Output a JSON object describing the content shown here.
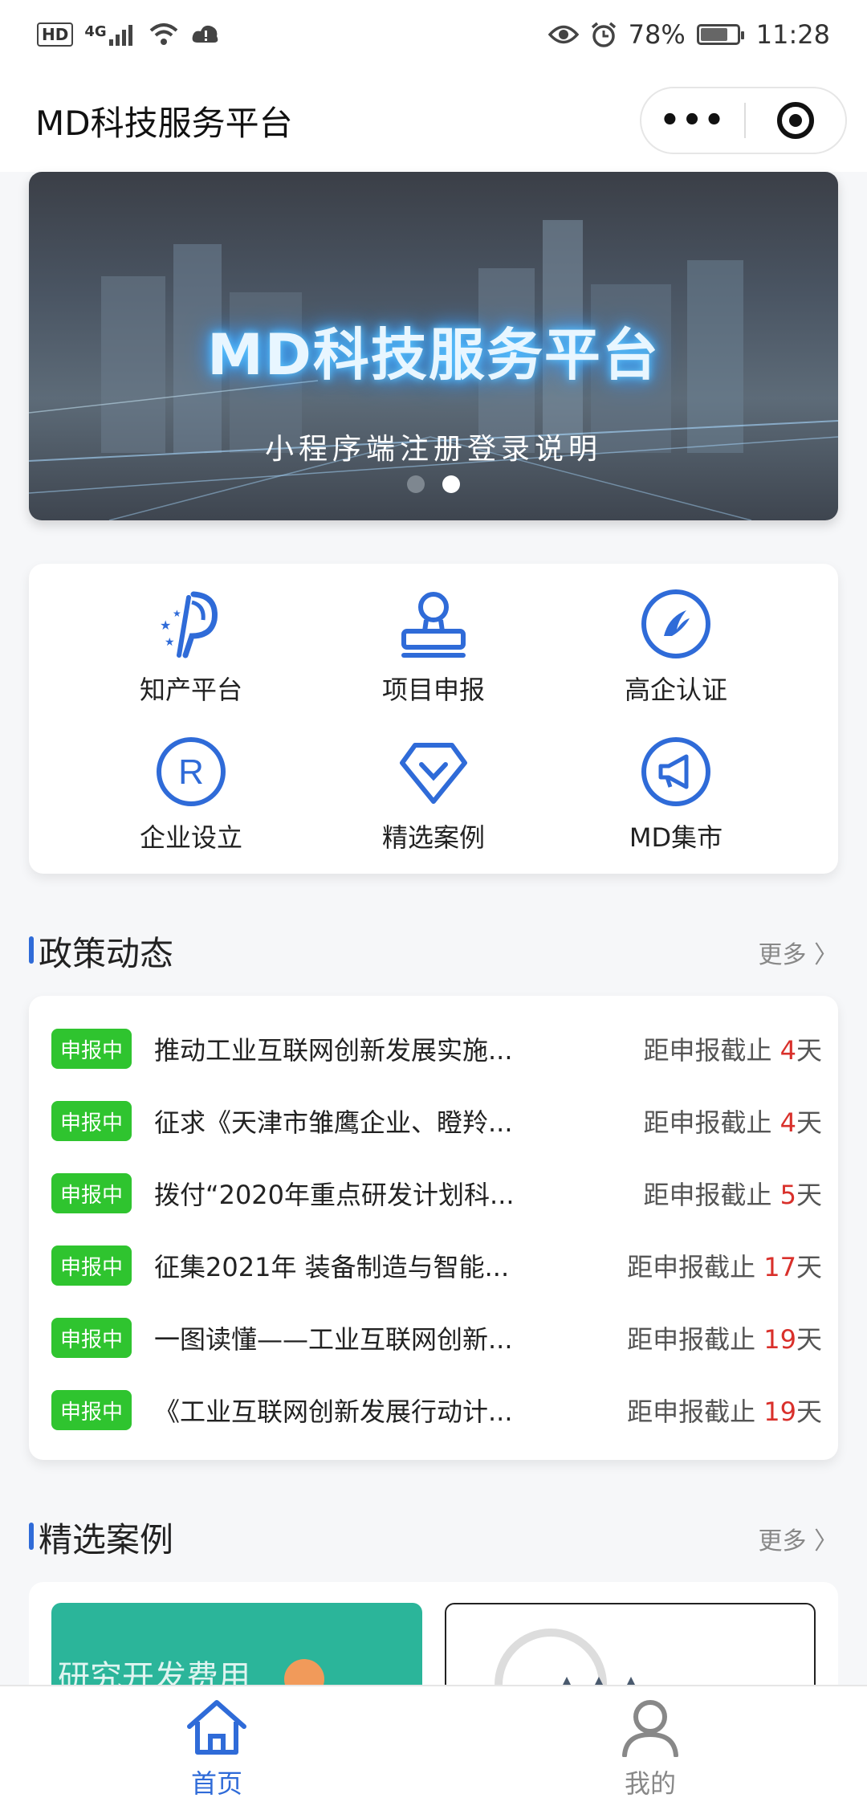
{
  "status_bar": {
    "hd": "HD",
    "network": "4G",
    "battery": "78%",
    "time": "11:28"
  },
  "nav": {
    "title": "MD科技服务平台",
    "more_glyph": "•••"
  },
  "banner": {
    "title": "MD科技服务平台",
    "subtitle": "小程序端注册登录说明",
    "active_dot": 2,
    "dot_count": 2
  },
  "services": [
    {
      "label": "知产平台",
      "icon": "ip-platform-icon"
    },
    {
      "label": "项目申报",
      "icon": "stamp-icon"
    },
    {
      "label": "高企认证",
      "icon": "hightech-certify-icon"
    },
    {
      "label": "企业设立",
      "icon": "registered-r-icon"
    },
    {
      "label": "精选案例",
      "icon": "diamond-icon"
    },
    {
      "label": "MD集市",
      "icon": "megaphone-icon"
    }
  ],
  "policy_section": {
    "title": "政策动态",
    "more": "更多 〉",
    "items": [
      {
        "badge": "申报中",
        "title": "推动工业互联网创新发展实施...",
        "deadline_prefix": "距申报截止 ",
        "days": "4",
        "unit": "天"
      },
      {
        "badge": "申报中",
        "title": "征求《天津市雏鹰企业、瞪羚...",
        "deadline_prefix": "距申报截止 ",
        "days": "4",
        "unit": "天"
      },
      {
        "badge": "申报中",
        "title": "拨付“2020年重点研发计划科...",
        "deadline_prefix": "距申报截止 ",
        "days": "5",
        "unit": "天"
      },
      {
        "badge": "申报中",
        "title": "征集2021年 装备制造与智能...",
        "deadline_prefix": "距申报截止 ",
        "days": "17",
        "unit": "天"
      },
      {
        "badge": "申报中",
        "title": "一图读懂——工业互联网创新...",
        "deadline_prefix": "距申报截止 ",
        "days": "19",
        "unit": "天"
      },
      {
        "badge": "申报中",
        "title": "《工业互联网创新发展行动计...",
        "deadline_prefix": "距申报截止 ",
        "days": "19",
        "unit": "天"
      }
    ]
  },
  "cases_section": {
    "title": "精选案例",
    "more": "更多 〉",
    "card1_text": "研究开发费用"
  },
  "tabbar": {
    "home": "首页",
    "mine": "我的"
  },
  "colors": {
    "accent_blue": "#2f6bd8",
    "badge_green": "#2fc42f",
    "deadline_red": "#d9302b"
  }
}
